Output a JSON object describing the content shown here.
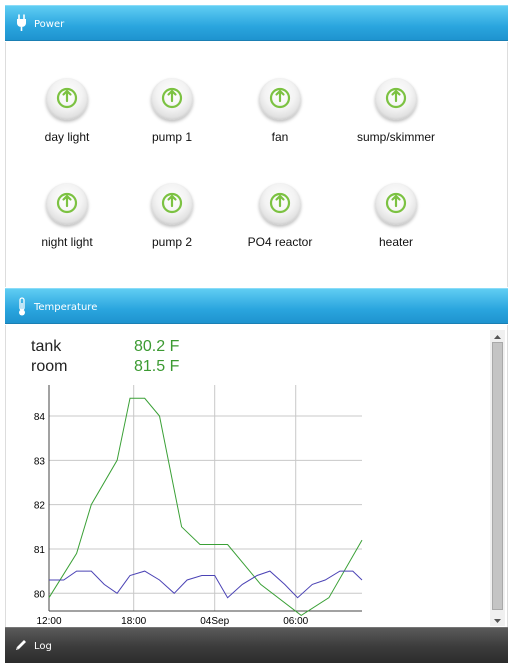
{
  "power": {
    "title": "Power",
    "buttons": [
      {
        "label": "day light"
      },
      {
        "label": "pump 1"
      },
      {
        "label": "fan"
      },
      {
        "label": "sump/skimmer"
      },
      {
        "label": "night light"
      },
      {
        "label": "pump 2"
      },
      {
        "label": "PO4 reactor"
      },
      {
        "label": "heater"
      }
    ]
  },
  "temperature": {
    "title": "Temperature",
    "readings": [
      {
        "name": "tank",
        "value": "80.2 F"
      },
      {
        "name": "room",
        "value": "81.5 F"
      }
    ]
  },
  "log": {
    "title": "Log"
  },
  "colors": {
    "accent": "#2aa5de",
    "on_green": "#7cc242",
    "reading_green": "#3c9a32",
    "series_green": "#3aa036",
    "series_blue": "#4b43b5"
  },
  "chart_data": {
    "type": "line",
    "title": "",
    "xlabel": "",
    "ylabel": "",
    "x_tick_labels": [
      "12:00",
      "18:00",
      "04Sep",
      "06:00"
    ],
    "y_ticks": [
      80,
      81,
      82,
      83,
      84
    ],
    "ylim": [
      79.6,
      84.7
    ],
    "xlim": [
      0,
      17
    ],
    "grid": true,
    "series": [
      {
        "color": "#3aa036",
        "x": [
          0,
          1.5,
          2.3,
          3.7,
          4.4,
          5.2,
          6,
          7.2,
          8.2,
          9.7,
          11.5,
          13.7,
          15.2,
          17
        ],
        "y": [
          79.9,
          80.9,
          82,
          83,
          84.4,
          84.4,
          84,
          81.5,
          81.1,
          81.1,
          80.2,
          79.5,
          79.9,
          81.2
        ]
      },
      {
        "color": "#4b43b5",
        "x": [
          0,
          0.8,
          1.5,
          2.3,
          3,
          3.7,
          4.4,
          5.2,
          6,
          6.8,
          7.5,
          8.3,
          9,
          9.7,
          10.5,
          11.3,
          12,
          12.8,
          13.5,
          14.3,
          15,
          15.8,
          16.5,
          17
        ],
        "y": [
          80.3,
          80.3,
          80.5,
          80.5,
          80.2,
          80,
          80.4,
          80.5,
          80.3,
          80,
          80.3,
          80.4,
          80.4,
          79.9,
          80.2,
          80.4,
          80.5,
          80.2,
          79.9,
          80.2,
          80.3,
          80.5,
          80.5,
          80.3
        ]
      }
    ]
  }
}
